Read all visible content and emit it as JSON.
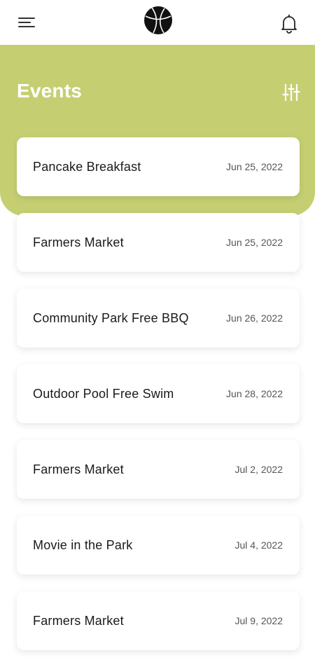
{
  "header": {
    "menu_icon": "hamburger-menu-icon",
    "logo_icon": "basketball-logo",
    "notification_icon": "bell-icon"
  },
  "hero": {
    "title": "Events",
    "filter_icon": "sliders-filter-icon",
    "background_color": "#c5cf72"
  },
  "events": [
    {
      "name": "Pancake Breakfast",
      "date": "Jun 25, 2022"
    },
    {
      "name": "Farmers Market",
      "date": "Jun 25, 2022"
    },
    {
      "name": "Community Park Free BBQ",
      "date": "Jun 26, 2022"
    },
    {
      "name": "Outdoor Pool Free Swim",
      "date": "Jun 28, 2022"
    },
    {
      "name": "Farmers Market",
      "date": "Jul 2, 2022"
    },
    {
      "name": "Movie in the Park",
      "date": "Jul 4, 2022"
    },
    {
      "name": "Farmers Market",
      "date": "Jul 9, 2022"
    }
  ]
}
